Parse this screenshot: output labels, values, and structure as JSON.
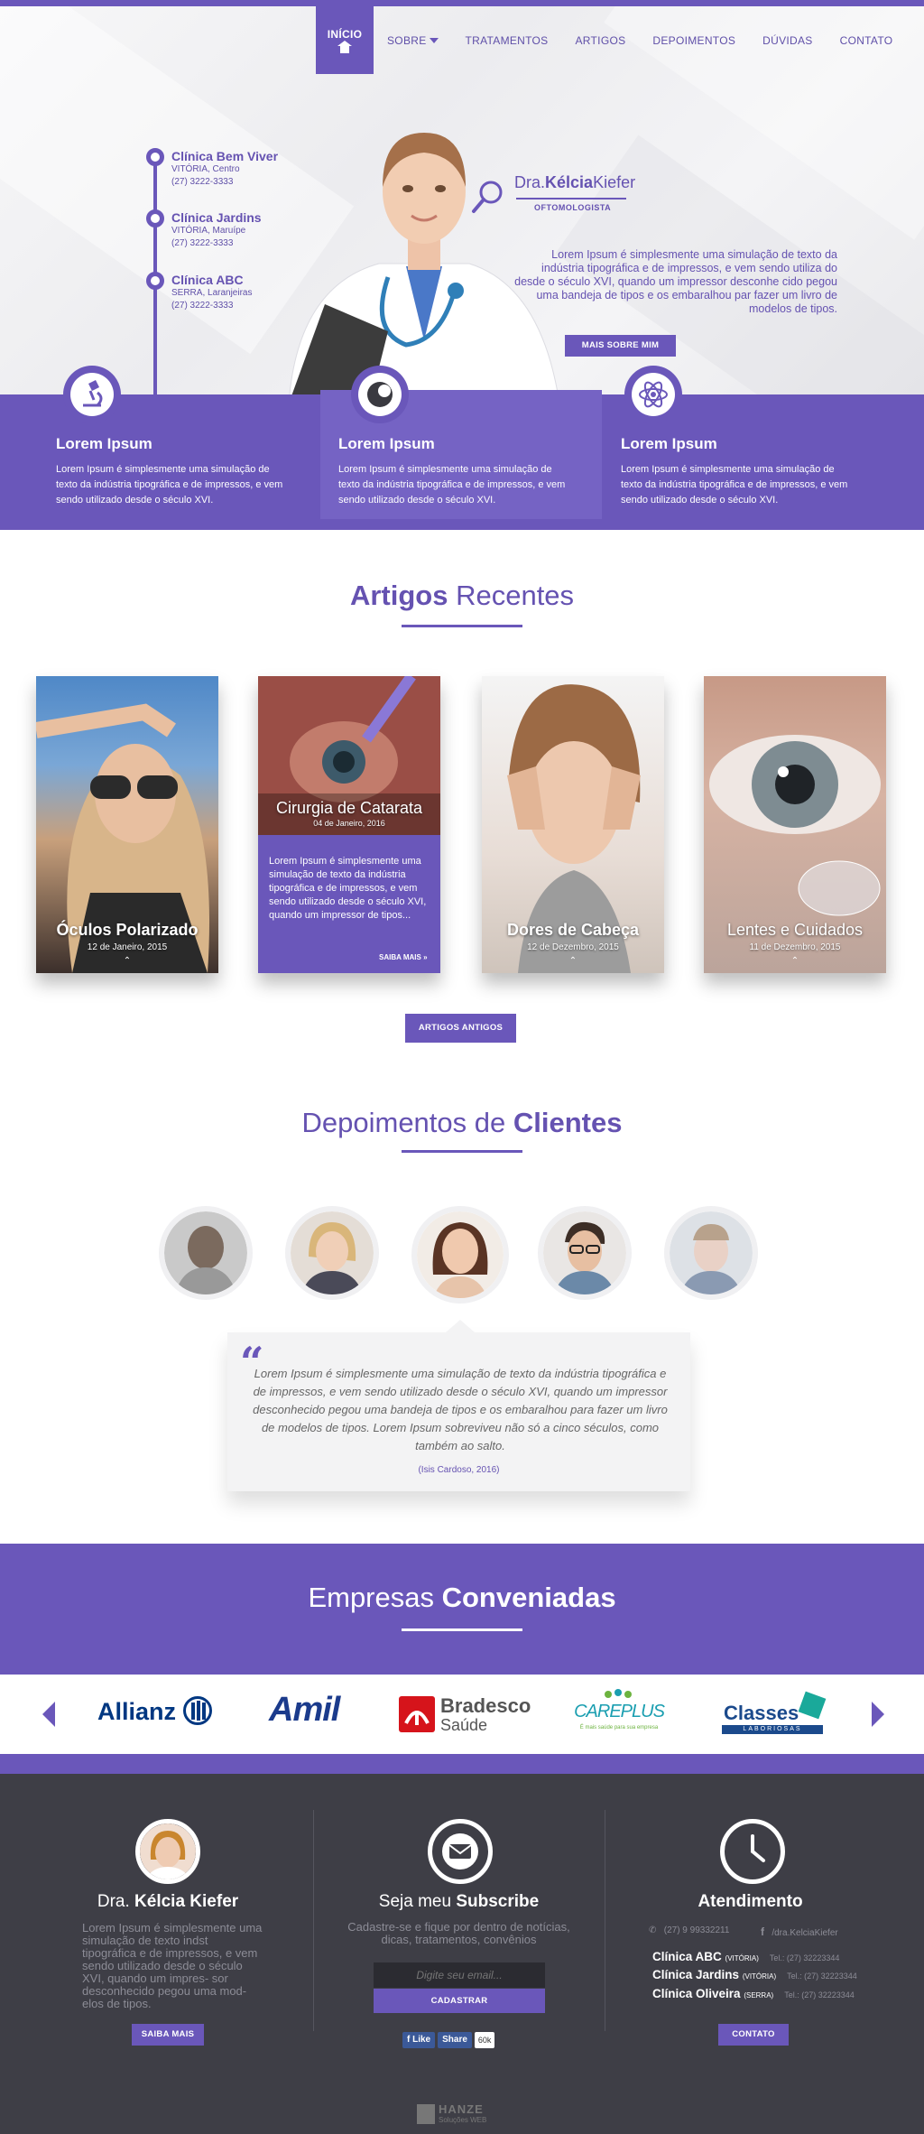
{
  "nav": {
    "items": [
      {
        "label": "INÍCIO",
        "active": true
      },
      {
        "label": "SOBRE",
        "has_dropdown": true
      },
      {
        "label": "TRATAMENTOS"
      },
      {
        "label": "ARTIGOS"
      },
      {
        "label": "DEPOIMENTOS"
      },
      {
        "label": "DÚVIDAS"
      },
      {
        "label": "CONTATO"
      }
    ]
  },
  "hero": {
    "clinics": [
      {
        "name": "Clínica Bem Viver",
        "city": "VITÓRIA, Centro",
        "phone": "(27) 3222-3333"
      },
      {
        "name": "Clínica Jardins",
        "city": "VITÓRIA, Maruípe",
        "phone": "(27) 3222-3333"
      },
      {
        "name": "Clínica ABC",
        "city": "SERRA, Laranjeiras",
        "phone": "(27) 3222-3333"
      }
    ],
    "doctor_prefix": "Dra.",
    "doctor_first": "Kélcia",
    "doctor_last": "Kiefer",
    "specialty": "OFTOMOLOGISTA",
    "text": "Lorem Ipsum é simplesmente uma simulação de texto da indústria tipográfica e de impressos, e vem sendo utiliza do desde o século XVI, quando um impressor desconhe cido pegou uma bandeja de tipos e os embaralhou par fazer um livro de modelos de tipos.",
    "button": "MAIS SOBRE MIM"
  },
  "features": [
    {
      "icon": "microscope-icon",
      "title": "Lorem Ipsum",
      "text": "Lorem Ipsum é simplesmente uma simulação de texto da indústria tipográfica e de impressos, e vem sendo utilizado desde o século XVI."
    },
    {
      "icon": "eye-icon",
      "title": "Lorem Ipsum",
      "text": "Lorem Ipsum é simplesmente uma simulação de texto da indústria tipográfica e de impressos, e vem sendo utilizado desde o século XVI."
    },
    {
      "icon": "atom-icon",
      "title": "Lorem Ipsum",
      "text": "Lorem Ipsum é simplesmente uma simulação de texto da indústria tipográfica e de impressos, e vem sendo utilizado desde o século XVI."
    }
  ],
  "articles": {
    "title_bold": "Artigos",
    "title_rest": "Recentes",
    "cards": [
      {
        "title": "Óculos Polarizado",
        "date": "12 de Janeiro, 2015"
      },
      {
        "title": "Cirurgia de Catarata",
        "date": "04 de Janeiro, 2016",
        "excerpt": "Lorem Ipsum é simplesmente uma simulação de texto da indústria tipográfica e de impressos, e vem sendo utilizado desde o século XVI, quando um impressor de tipos...",
        "more": "SAIBA MAIS"
      },
      {
        "title": "Dores de Cabeça",
        "date": "12 de Dezembro, 2015"
      },
      {
        "title": "Lentes e Cuidados",
        "date": "11 de Dezembro, 2015"
      }
    ],
    "button": "ARTIGOS ANTIGOS"
  },
  "testimonials": {
    "title_rest": "Depoimentos de",
    "title_bold": "Clientes",
    "quote": "Lorem Ipsum é simplesmente uma simulação de texto da indústria tipográfica e de impressos, e vem sendo utilizado desde o século XVI, quando um impressor desconhecido pegou uma bandeja de tipos e os embaralhou para fazer um livro de modelos de tipos. Lorem Ipsum sobreviveu não só a cinco séculos, como também ao salto.",
    "author": "(Isis Cardoso, 2016)"
  },
  "partners": {
    "title_rest": "Empresas",
    "title_bold": "Conveniadas",
    "logos": [
      {
        "name": "Allianz",
        "color": "#003781"
      },
      {
        "name": "Amil",
        "color": "#1b3b8c"
      },
      {
        "name": "Bradesco",
        "sub": "Saúde",
        "color": "#d6141b"
      },
      {
        "name": "CAREPLUS",
        "sub": "É mais saúde para sua empresa",
        "color": "#1a9eb0"
      },
      {
        "name": "Classes",
        "sub": "LABORIOSAS",
        "color": "#1b4a8c"
      }
    ]
  },
  "footer": {
    "about": {
      "name_prefix": "Dra.",
      "name_first": "Kélcia",
      "name_last": "Kiefer",
      "text": "Lorem Ipsum é simplesmente uma simulação de texto indst tipográfica e de impressos, e vem sendo utilizado desde o século XVI, quando um impres- sor desconhecido pegou uma mod- elos de tipos.",
      "button": "SAIBA MAIS"
    },
    "subscribe": {
      "title_rest": "Seja meu",
      "title_bold": "Subscribe",
      "text": "Cadastre-se e fique por dentro de notícias, dicas, tratamentos, convênios",
      "placeholder": "Digite seu email...",
      "button": "CADASTRAR",
      "like": "Like",
      "share": "Share",
      "count": "60k"
    },
    "service": {
      "title": "Atendimento",
      "phone": "(27) 9 99332211",
      "facebook": "/dra.KelciaKiefer",
      "clinics": [
        {
          "name": "Clínica ABC",
          "city": "(VITÓRIA)",
          "tel": "Tel.: (27) 32223344"
        },
        {
          "name": "Clínica Jardins",
          "city": "(VITÓRIA)",
          "tel": "Tel.: (27) 32223344"
        },
        {
          "name": "Clínica Oliveira",
          "city": "(SERRA)",
          "tel": "Tel.: (27) 32223344"
        }
      ],
      "button": "CONTATO"
    },
    "credit": "HANZE",
    "credit_sub": "Soluções WEB"
  },
  "colors": {
    "accent": "#6a57ba",
    "footer_bg": "#3e3e46"
  }
}
